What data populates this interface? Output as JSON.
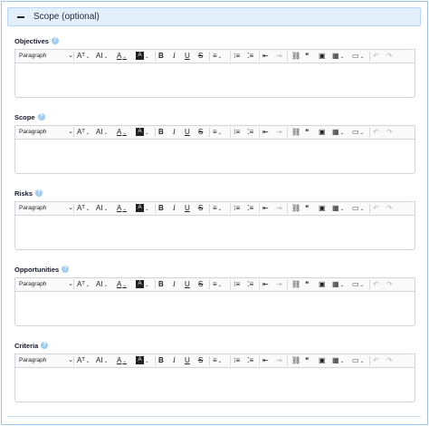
{
  "section": {
    "title": "Scope (optional)"
  },
  "help_glyph": "?",
  "toolbar": {
    "paragraph": "Paragraph",
    "chevron": "⌄",
    "font_size": "Aᵀ",
    "font_family": "AI",
    "font_color": "A",
    "highlight": "A",
    "bold": "B",
    "italic": "I",
    "underline": "U",
    "strikethrough": "S",
    "align": "≡",
    "numbered_list": "⁝≡",
    "bulleted_list": "⁚≡",
    "outdent": "⇤",
    "indent": "⇥",
    "link": "⛓",
    "blockquote": "❝",
    "image": "▣",
    "table": "▦",
    "media": "▭",
    "undo": "↶",
    "redo": "↷"
  },
  "fields": [
    {
      "label": "Objectives"
    },
    {
      "label": "Scope"
    },
    {
      "label": "Risks"
    },
    {
      "label": "Opportunities"
    },
    {
      "label": "Criteria"
    }
  ]
}
